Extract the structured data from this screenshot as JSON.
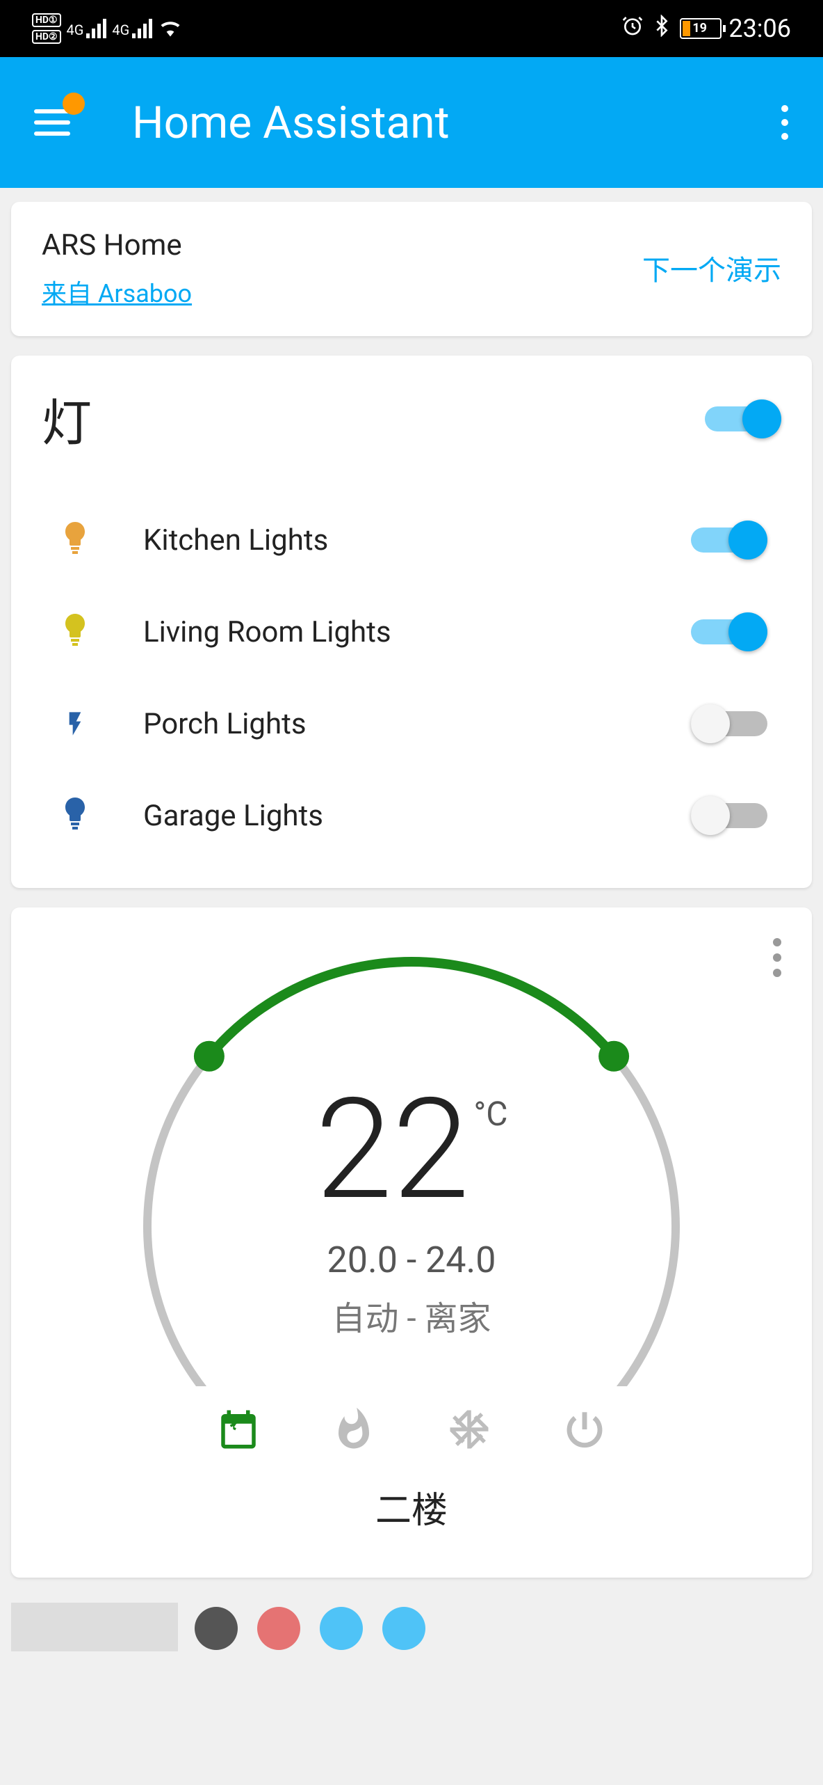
{
  "status": {
    "hd1": "HD①",
    "hd2": "HD②",
    "sig1": "4G",
    "sig2": "4G",
    "battery_pct": "19",
    "time": "23:06"
  },
  "appbar": {
    "title": "Home Assistant"
  },
  "card_home": {
    "title": "ARS Home",
    "subtitle": "来自 Arsaboo",
    "next_demo": "下一个演示"
  },
  "lights": {
    "title": "灯",
    "master_on": true,
    "items": [
      {
        "label": "Kitchen Lights",
        "icon": "bulb",
        "color": "#e8a33d",
        "on": true
      },
      {
        "label": "Living Room Lights",
        "icon": "bulb",
        "color": "#d4c21f",
        "on": true
      },
      {
        "label": "Porch Lights",
        "icon": "flash",
        "color": "#2962a8",
        "on": false
      },
      {
        "label": "Garage Lights",
        "icon": "bulb",
        "color": "#2962a8",
        "on": false
      }
    ]
  },
  "thermostat": {
    "temp": "22",
    "unit": "°C",
    "range": "20.0 - 24.0",
    "status": "自动 - 离家",
    "name": "二楼",
    "modes": [
      {
        "name": "calendar",
        "active": true
      },
      {
        "name": "fire",
        "active": false
      },
      {
        "name": "snowflake",
        "active": false
      },
      {
        "name": "power",
        "active": false
      }
    ],
    "arc": {
      "start_angle": -220,
      "low_angle": -140,
      "high_angle": -40,
      "end_angle": 40
    }
  }
}
